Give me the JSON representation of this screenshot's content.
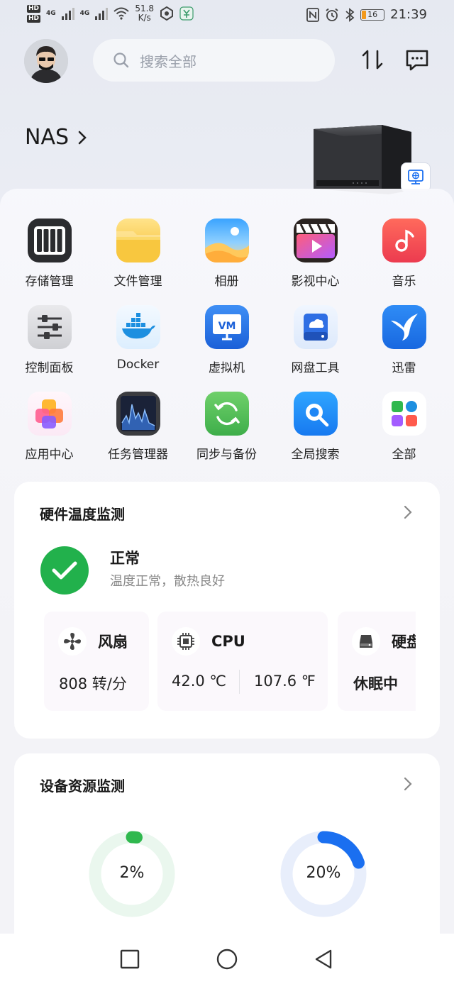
{
  "status_bar": {
    "sim1": "HD",
    "sim2": "HD",
    "net1": "4G",
    "net2": "4G",
    "speed_value": "51.8",
    "speed_unit": "K/s",
    "battery": "16",
    "time": "21:39"
  },
  "header": {
    "search_placeholder": "搜索全部",
    "device_name": "NAS"
  },
  "apps": [
    {
      "label": "存储管理",
      "icon": "storage-icon"
    },
    {
      "label": "文件管理",
      "icon": "folder-icon"
    },
    {
      "label": "相册",
      "icon": "photo-icon"
    },
    {
      "label": "影视中心",
      "icon": "video-icon"
    },
    {
      "label": "音乐",
      "icon": "music-icon"
    },
    {
      "label": "控制面板",
      "icon": "control-panel-icon"
    },
    {
      "label": "Docker",
      "icon": "docker-icon"
    },
    {
      "label": "虚拟机",
      "icon": "vm-icon"
    },
    {
      "label": "网盘工具",
      "icon": "cloud-drive-icon"
    },
    {
      "label": "迅雷",
      "icon": "thunder-icon"
    },
    {
      "label": "应用中心",
      "icon": "app-center-icon"
    },
    {
      "label": "任务管理器",
      "icon": "task-manager-icon"
    },
    {
      "label": "同步与备份",
      "icon": "sync-icon"
    },
    {
      "label": "全局搜索",
      "icon": "global-search-icon"
    },
    {
      "label": "全部",
      "icon": "all-apps-icon"
    }
  ],
  "temperature_card": {
    "title": "硬件温度监测",
    "status_title": "正常",
    "status_sub": "温度正常，散热良好",
    "fan": {
      "label": "风扇",
      "value": "808 转/分"
    },
    "cpu": {
      "label": "CPU",
      "celsius": "42.0 ℃",
      "fahrenheit": "107.6 ℉"
    },
    "disk": {
      "label": "硬盘",
      "value": "休眠中"
    }
  },
  "resource_card": {
    "title": "设备资源监测",
    "gauges": [
      {
        "label": "2%",
        "value": 0.02,
        "color": "#2fb84e",
        "track": "#eaf7ee"
      },
      {
        "label": "20%",
        "value": 0.2,
        "color": "#1a6ff0",
        "track": "#e8eefb"
      }
    ]
  },
  "colors": {
    "ok_green": "#22b14c",
    "accent_blue": "#1a6ff0"
  }
}
